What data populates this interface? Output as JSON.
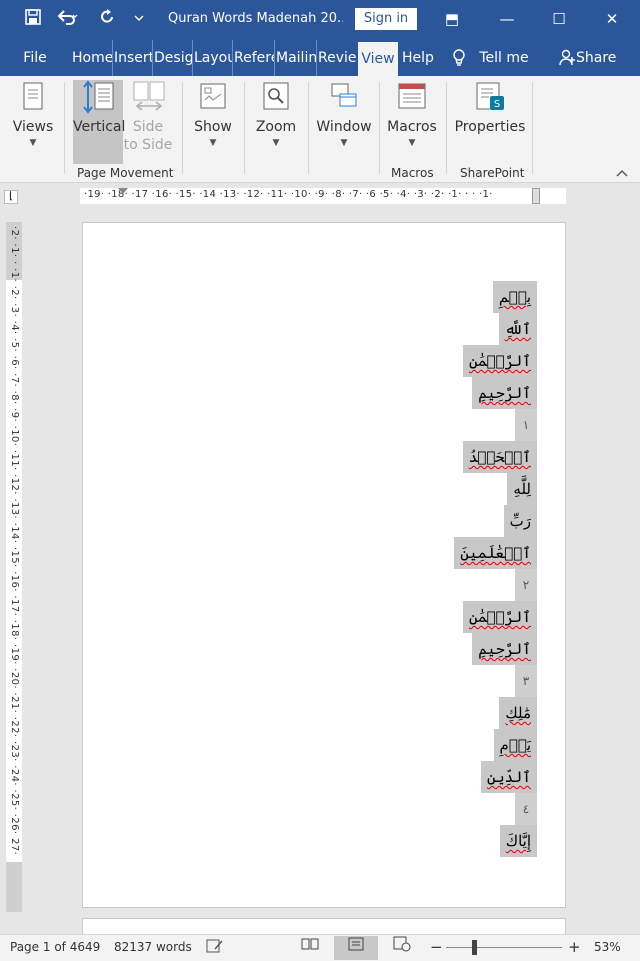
{
  "app": {
    "document_title": "Quran Words Madenah 20...",
    "sign_in": "Sign in"
  },
  "quick_access": [
    "save-icon",
    "undo-icon",
    "redo-icon",
    "customize-icon"
  ],
  "window_controls": {
    "ribbon_display": "⬒",
    "minimize": "—",
    "maximize": "☐",
    "close": "✕"
  },
  "tabs": [
    {
      "label": "File"
    },
    {
      "label": "Home"
    },
    {
      "label": "Insert"
    },
    {
      "label": "Design"
    },
    {
      "label": "Layout"
    },
    {
      "label": "References"
    },
    {
      "label": "Mailings"
    },
    {
      "label": "Review"
    },
    {
      "label": "View"
    },
    {
      "label": "Help"
    },
    {
      "label": "Tell me"
    },
    {
      "label": "Share"
    }
  ],
  "ribbon": {
    "views": {
      "label": "Views"
    },
    "vertical": {
      "label": "Vertical"
    },
    "side_to_side": {
      "label_1": "Side",
      "label_2": "to Side"
    },
    "show": {
      "label": "Show"
    },
    "zoom": {
      "label": "Zoom"
    },
    "window": {
      "label": "Window"
    },
    "macros": {
      "label": "Macros"
    },
    "properties": {
      "label": "Properties"
    },
    "groups": {
      "page_movement": "Page Movement",
      "macros": "Macros",
      "sharepoint": "SharePoint"
    }
  },
  "rulers": {
    "horizontal": "·19· ·18· ·17 ·16· ·15· ·14 ·13· ·12· ·11· ·10· ·9· ·8· ·7· ·6 ·5· ·4· ·3· ·2· ·1· · · ·1·",
    "vertical": "·2· ·1· · ·1· ·2· ·3· ·4· ·5· ·6· ·7· ·8· ·9· ·10· ·11· ·12· ·13· ·14· ·15· ·16· ·17· ·18· ·19· ·20· ·21· ·22· ·23· ·24· ·25· ·26· 27·"
  },
  "document": {
    "words": [
      {
        "text": "بِسۡمِ",
        "kind": "word"
      },
      {
        "text": "ٱللَّهِ",
        "kind": "word"
      },
      {
        "text": "ٱلرَّحۡمَٰنِ",
        "kind": "word"
      },
      {
        "text": "ٱلرَّحِيمِ",
        "kind": "word"
      },
      {
        "text": "١",
        "kind": "verse"
      },
      {
        "text": "ٱلۡحَمۡدُ",
        "kind": "word"
      },
      {
        "text": "لِلَّهِ",
        "kind": "word"
      },
      {
        "text": "رَبِّ",
        "kind": "word"
      },
      {
        "text": "ٱلۡعَٰلَمِينَ",
        "kind": "word"
      },
      {
        "text": "٢",
        "kind": "verse"
      },
      {
        "text": "ٱلرَّحۡمَٰنِ",
        "kind": "word"
      },
      {
        "text": "ٱلرَّحِيمِ",
        "kind": "word"
      },
      {
        "text": "٣",
        "kind": "verse"
      },
      {
        "text": "مَٰلِكِ",
        "kind": "word"
      },
      {
        "text": "يَوۡمِ",
        "kind": "word"
      },
      {
        "text": "ٱلدِّينِ",
        "kind": "word"
      },
      {
        "text": "٤",
        "kind": "verse"
      },
      {
        "text": "إِيَّاكَ",
        "kind": "word"
      }
    ]
  },
  "status": {
    "page": "Page 1 of 4649",
    "words": "82137 words",
    "zoom_minus": "−",
    "zoom_plus": "+",
    "zoom_level": "53%",
    "zoom_fraction": 0.53
  },
  "colors": {
    "accent": "#2b579a",
    "spell_error": "#e00000",
    "word_highlight": "#c8c8c8"
  }
}
